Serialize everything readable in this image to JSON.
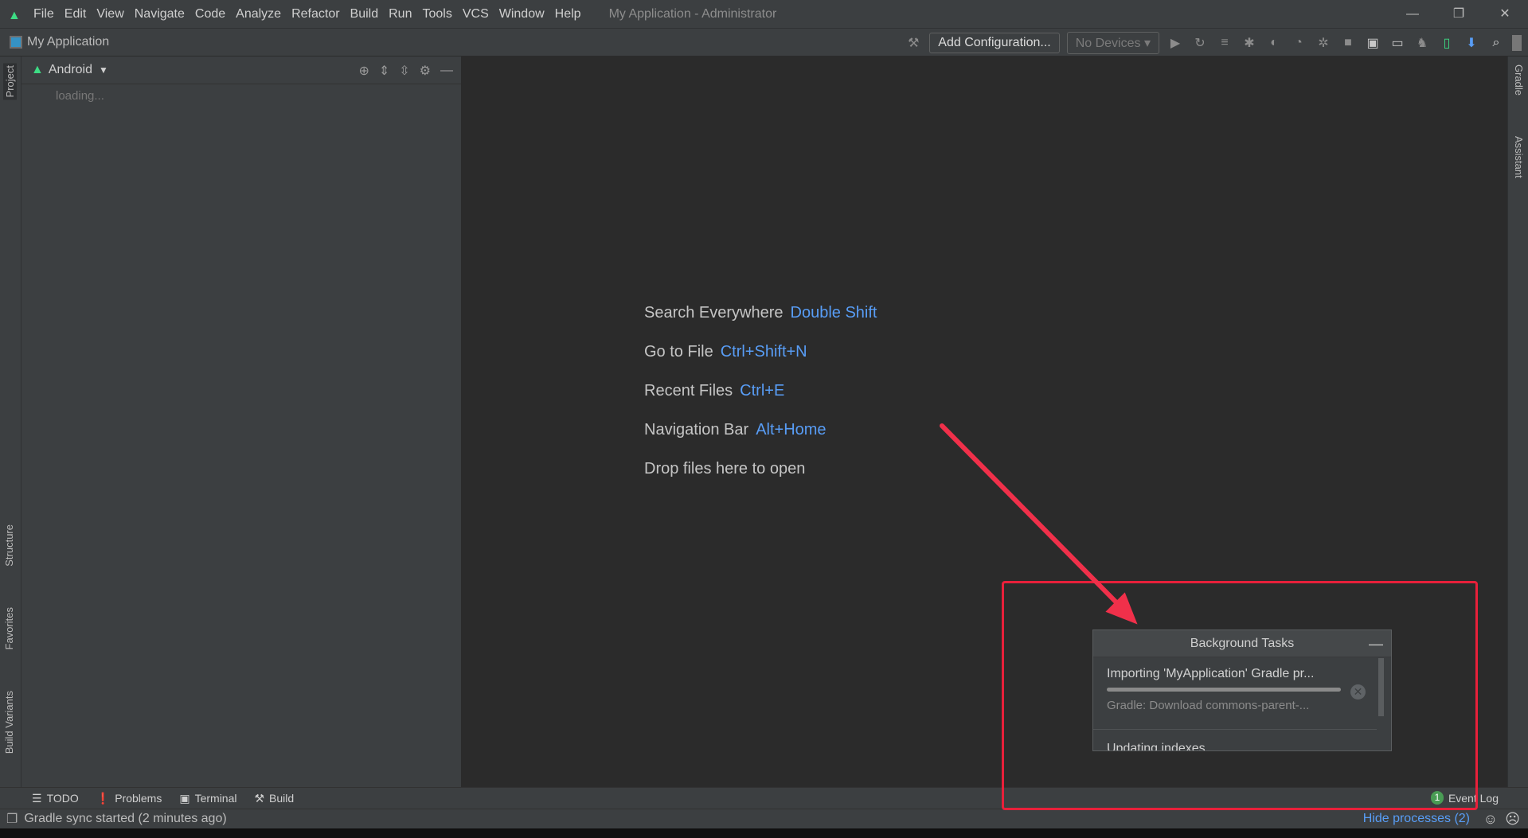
{
  "menubar": {
    "items": [
      "File",
      "Edit",
      "View",
      "Navigate",
      "Code",
      "Analyze",
      "Refactor",
      "Build",
      "Run",
      "Tools",
      "VCS",
      "Window",
      "Help"
    ],
    "window_title": "My Application - Administrator",
    "window_buttons": [
      "—",
      "❐",
      "✕"
    ]
  },
  "toolbar": {
    "project_name": "My Application",
    "add_configuration": "Add Configuration...",
    "devices": "No Devices"
  },
  "left_strip": {
    "tabs": [
      "Project",
      "Structure",
      "Favorites",
      "Build Variants"
    ]
  },
  "project_panel": {
    "view": "Android",
    "loading": "loading..."
  },
  "right_strip": {
    "tabs": [
      "Gradle",
      "Assistant"
    ]
  },
  "welcome": [
    {
      "label": "Search Everywhere",
      "shortcut": "Double Shift"
    },
    {
      "label": "Go to File",
      "shortcut": "Ctrl+Shift+N"
    },
    {
      "label": "Recent Files",
      "shortcut": "Ctrl+E"
    },
    {
      "label": "Navigation Bar",
      "shortcut": "Alt+Home"
    },
    {
      "label": "Drop files here to open",
      "shortcut": ""
    }
  ],
  "bottom_tabs": [
    "TODO",
    "Problems",
    "Terminal",
    "Build"
  ],
  "event_log": {
    "label": "Event Log",
    "count": "1"
  },
  "status": {
    "message": "Gradle sync started (2 minutes ago)",
    "hide_processes": "Hide processes (2)"
  },
  "background_tasks": {
    "title": "Background Tasks",
    "tasks": [
      {
        "title": "Importing 'MyApplication' Gradle pr...",
        "subtitle": "Gradle: Download commons-parent-...",
        "progress": 1.0
      },
      {
        "title": "Updating indexes"
      }
    ]
  },
  "colors": {
    "accent": "#589df6",
    "annotation": "#e8203a",
    "android": "#3ddc84"
  }
}
